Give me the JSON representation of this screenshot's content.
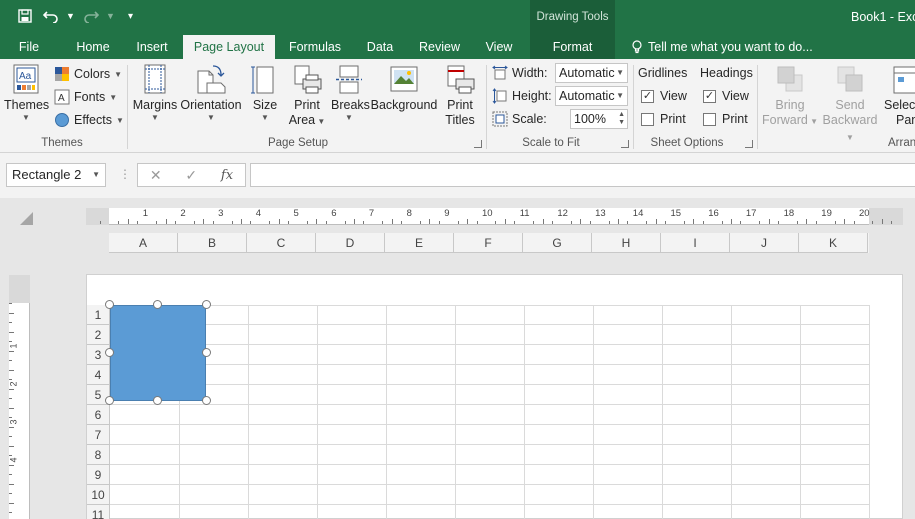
{
  "title_bar": {
    "contextual_group": "Drawing Tools",
    "document_title": "Book1 - Exce"
  },
  "tabs": {
    "file": "File",
    "home": "Home",
    "insert": "Insert",
    "page_layout": "Page Layout",
    "formulas": "Formulas",
    "data": "Data",
    "review": "Review",
    "view": "View",
    "format": "Format",
    "active": "Page Layout"
  },
  "tell_me": "Tell me what you want to do...",
  "ribbon": {
    "themes_group": {
      "label": "Themes",
      "themes_button": "Themes",
      "colors": "Colors",
      "fonts": "Fonts",
      "effects": "Effects"
    },
    "page_setup_group": {
      "label": "Page Setup",
      "margins": "Margins",
      "orientation": "Orientation",
      "size": "Size",
      "print_area_1": "Print",
      "print_area_2": "Area",
      "breaks": "Breaks",
      "background": "Background",
      "print_titles_1": "Print",
      "print_titles_2": "Titles"
    },
    "scale_group": {
      "label": "Scale to Fit",
      "width_label": "Width:",
      "width_value": "Automatic",
      "height_label": "Height:",
      "height_value": "Automatic",
      "scale_label": "Scale:",
      "scale_value": "100%"
    },
    "sheet_options_group": {
      "label": "Sheet Options",
      "gridlines": "Gridlines",
      "headings": "Headings",
      "gridlines_view": "View",
      "gridlines_print": "Print",
      "headings_view": "View",
      "headings_print": "Print",
      "gridlines_view_checked": true,
      "gridlines_print_checked": false,
      "headings_view_checked": true,
      "headings_print_checked": false
    },
    "arrange_group": {
      "label": "Arran",
      "bring_forward_1": "Bring",
      "bring_forward_2": "Forward",
      "send_backward_1": "Send",
      "send_backward_2": "Backward",
      "selection_pane_1": "Select",
      "selection_pane_2": "Pan"
    }
  },
  "formula_bar": {
    "name_box": "Rectangle 2",
    "cancel_symbol": "✕",
    "enter_symbol": "✓",
    "fx_label": "fx",
    "formula_value": ""
  },
  "ruler": {
    "numbers": [
      "1",
      "2",
      "3",
      "4",
      "5",
      "6",
      "7",
      "8",
      "9",
      "10",
      "11",
      "12",
      "13",
      "14",
      "15",
      "16",
      "17",
      "18",
      "19",
      "20"
    ],
    "vertical_numbers": [
      "1",
      "2",
      "3",
      "4"
    ]
  },
  "sheet": {
    "columns": [
      "A",
      "B",
      "C",
      "D",
      "E",
      "F",
      "G",
      "H",
      "I",
      "J",
      "K"
    ],
    "rows": [
      "1",
      "2",
      "3",
      "4",
      "5",
      "6",
      "7",
      "8",
      "9",
      "10",
      "11"
    ]
  },
  "shape": {
    "name": "Rectangle 2",
    "fill_color": "#5b9bd5"
  },
  "colors": {
    "excel_green": "#217346",
    "ribbon_bg": "#f3f3f3"
  }
}
